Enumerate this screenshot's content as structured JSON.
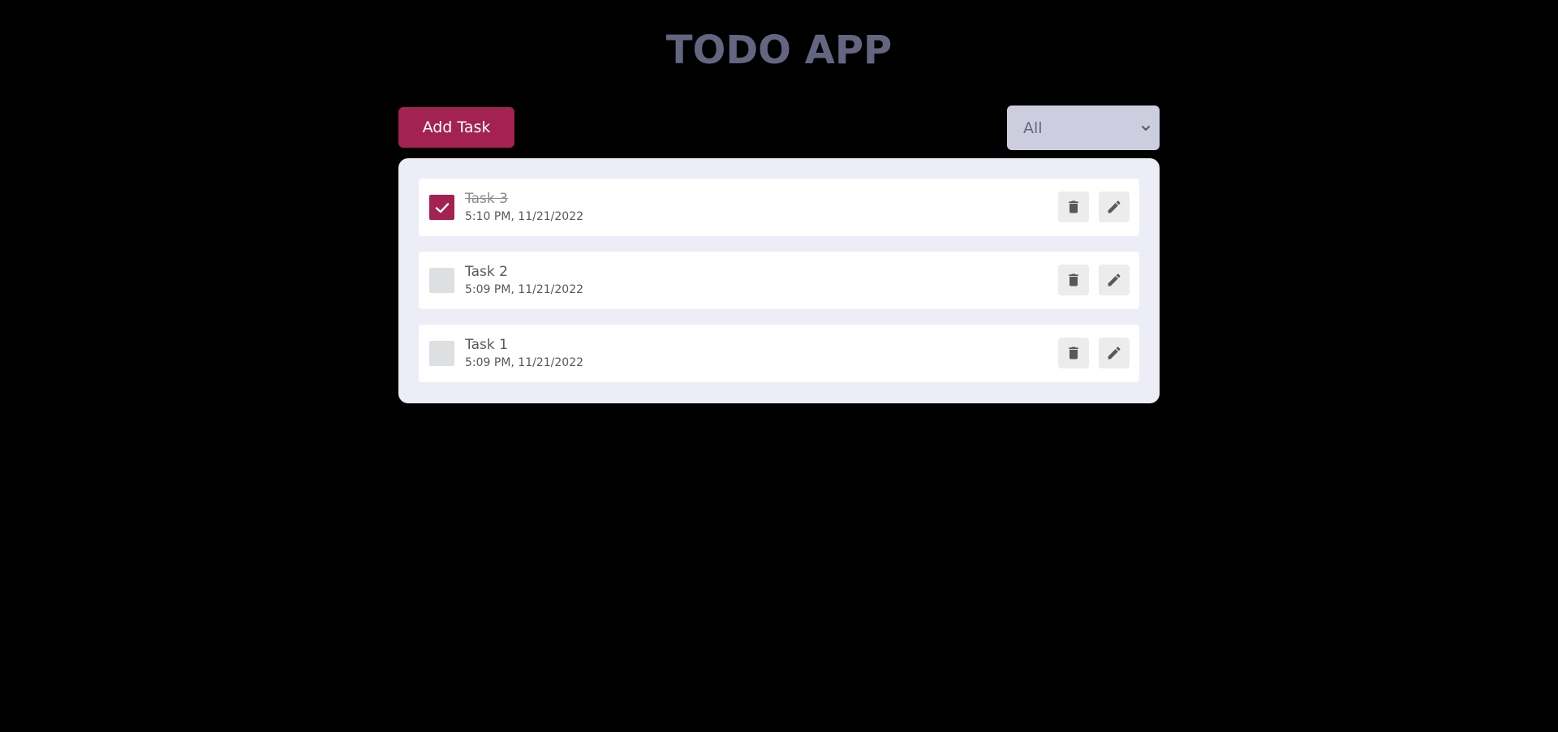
{
  "app": {
    "title": "TODO APP"
  },
  "colors": {
    "title": "#646681",
    "accent": "#a32250",
    "panel_bg": "#ecedf6",
    "select_bg": "#cccdde",
    "icon": "#585858"
  },
  "toolbar": {
    "add_task_label": "Add Task",
    "filter": {
      "selected": "All"
    }
  },
  "tasks": [
    {
      "title": "Task 3",
      "time": "5:10 PM, 11/21/2022",
      "completed": true
    },
    {
      "title": "Task 2",
      "time": "5:09 PM, 11/21/2022",
      "completed": false
    },
    {
      "title": "Task 1",
      "time": "5:09 PM, 11/21/2022",
      "completed": false
    }
  ],
  "icons": {
    "delete": "trash-icon",
    "edit": "pencil-icon",
    "check": "check-icon",
    "dropdown": "chevron-down-icon"
  }
}
